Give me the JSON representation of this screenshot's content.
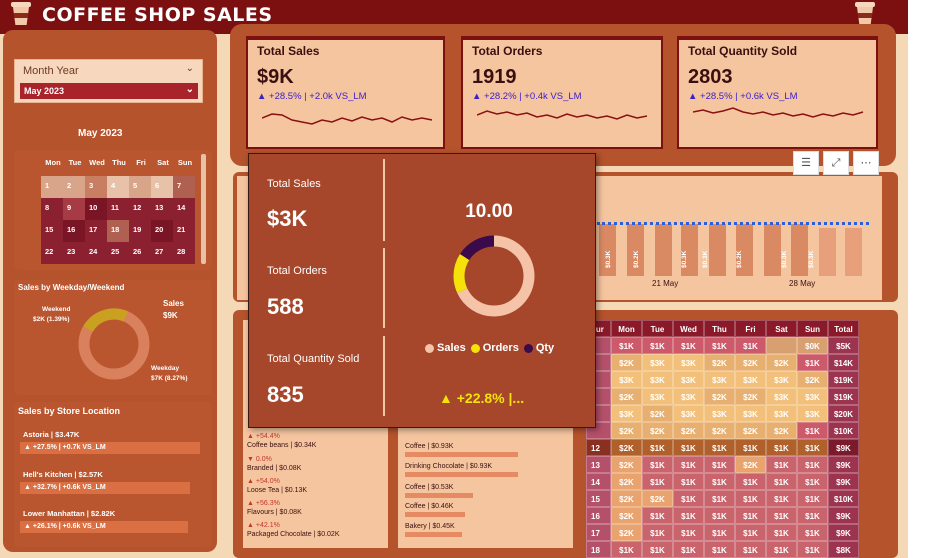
{
  "app": {
    "title": "COFFEE SHOP SALES"
  },
  "filters": {
    "month_year_label": "Month Year",
    "month_year_value": "May 2023"
  },
  "calendar": {
    "title": "May 2023",
    "weekdays": [
      "Mon",
      "Tue",
      "Wed",
      "Thu",
      "Fri",
      "Sat",
      "Sun"
    ],
    "weeks": [
      [
        "1",
        "2",
        "3",
        "4",
        "5",
        "6",
        "7"
      ],
      [
        "8",
        "9",
        "10",
        "11",
        "12",
        "13",
        "14"
      ],
      [
        "15",
        "16",
        "17",
        "18",
        "19",
        "20",
        "21"
      ],
      [
        "22",
        "23",
        "24",
        "25",
        "26",
        "27",
        "28"
      ]
    ],
    "colors": [
      [
        "#d9a58a",
        "#d9a58a",
        "#c77e63",
        "#e8c2a8",
        "#d9a58a",
        "#e8c2a8",
        "#b06050"
      ],
      [
        "#8a2030",
        "#a63a45",
        "#7a1525",
        "#8a2030",
        "#8a2030",
        "#8a2030",
        "#8a2030"
      ],
      [
        "#8a2030",
        "#7a1525",
        "#8a2030",
        "#b06050",
        "#8a2030",
        "#7a1525",
        "#8a2030"
      ],
      [
        "#8a2030",
        "#8a2030",
        "#8a2030",
        "#8a2030",
        "#8a2030",
        "#8a2030",
        "#8a2030"
      ]
    ]
  },
  "weekday_weekend": {
    "title": "Sales by Weekday/Weekend",
    "weekend_label": "Weekend",
    "weekend_value": "$2K (1.39%)",
    "sales_label": "Sales",
    "sales_value": "$9K",
    "weekday_label": "Weekday",
    "weekday_value": "$7K (8.27%)",
    "weekend_share": 0.23,
    "colors": {
      "weekday": "#d9805c",
      "weekend": "#c9a020"
    }
  },
  "store_location": {
    "title": "Sales by Store Location",
    "stores": [
      {
        "name": "Astoria | $3.47K",
        "delta": "▲ +27.5% | +0.7k VS_LM"
      },
      {
        "name": "Hell's Kitchen | $2.57K",
        "delta": "▲ +32.7% | +0.6k VS_LM"
      },
      {
        "name": "Lower Manhattan | $2.82K",
        "delta": "▲ +26.1% | +0.6k VS_LM"
      }
    ]
  },
  "kpis": [
    {
      "title": "Total Sales",
      "value": "$9K",
      "delta": "▲ +28.5% | +2.0k VS_LM"
    },
    {
      "title": "Total Orders",
      "value": "1919",
      "delta": "▲ +28.2% | +0.4k VS_LM"
    },
    {
      "title": "Total Quantity Sold",
      "value": "2803",
      "delta": "▲ +28.5% | +0.6k VS_LM"
    }
  ],
  "toolbar": {
    "filter_icon": "filter-icon",
    "focus_icon": "focus-mode-icon",
    "more_icon": "more-options-icon"
  },
  "daily_chart": {
    "type": "bar",
    "labels": [
      "$0.3K",
      "$0.2K",
      "$0.3K",
      "$0.3K",
      "$0.2K",
      "$0.3K",
      "$0.3K"
    ],
    "x_ticks": [
      "21 May",
      "28 May"
    ],
    "average_line_color": "#2b5fd9"
  },
  "categories": [
    {
      "change": "▲ +54.4%",
      "name": "Coffee beans | $0.34K"
    },
    {
      "change": "▼ 0.0%",
      "name": "Branded | $0.08K"
    },
    {
      "change": "▲ +54.0%",
      "name": "Loose Tea | $0.13K"
    },
    {
      "change": "▲ +56.3%",
      "name": "Flavours | $0.08K"
    },
    {
      "change": "▲ +42.1%",
      "name": "Packaged Chocolate | $0.02K"
    }
  ],
  "products": [
    {
      "name": "Coffee | $0.93K",
      "share": 0.75
    },
    {
      "name": "Drinking Chocolate | $0.93K",
      "share": 0.75
    },
    {
      "name": "Coffee | $0.53K",
      "share": 0.45
    },
    {
      "name": "Coffee | $0.46K",
      "share": 0.4
    },
    {
      "name": "Bakery | $0.45K",
      "share": 0.38
    }
  ],
  "heatmap": {
    "headers": [
      "our",
      "Mon",
      "Tue",
      "Wed",
      "Thu",
      "Fri",
      "Sat",
      "Sun",
      "Total"
    ],
    "rows": [
      [
        "",
        "$1K",
        "$1K",
        "$1K",
        "$1K",
        "$1K",
        "",
        "$0K",
        "$5K"
      ],
      [
        "",
        "$2K",
        "$3K",
        "$3K",
        "$2K",
        "$2K",
        "$2K",
        "$1K",
        "$14K"
      ],
      [
        "",
        "$3K",
        "$3K",
        "$3K",
        "$3K",
        "$3K",
        "$3K",
        "$2K",
        "$19K"
      ],
      [
        "",
        "$2K",
        "$3K",
        "$3K",
        "$2K",
        "$2K",
        "$3K",
        "$3K",
        "$19K"
      ],
      [
        "",
        "$3K",
        "$2K",
        "$3K",
        "$3K",
        "$3K",
        "$3K",
        "$3K",
        "$20K"
      ],
      [
        "",
        "$2K",
        "$2K",
        "$2K",
        "$2K",
        "$2K",
        "$2K",
        "$1K",
        "$10K"
      ],
      [
        "12",
        "$2K",
        "$1K",
        "$1K",
        "$1K",
        "$1K",
        "$1K",
        "$1K",
        "$9K"
      ],
      [
        "13",
        "$2K",
        "$1K",
        "$1K",
        "$1K",
        "$2K",
        "$1K",
        "$1K",
        "$9K"
      ],
      [
        "14",
        "$2K",
        "$1K",
        "$1K",
        "$1K",
        "$1K",
        "$1K",
        "$1K",
        "$9K"
      ],
      [
        "15",
        "$2K",
        "$2K",
        "$1K",
        "$1K",
        "$1K",
        "$1K",
        "$1K",
        "$10K"
      ],
      [
        "16",
        "$2K",
        "$1K",
        "$1K",
        "$1K",
        "$1K",
        "$1K",
        "$1K",
        "$9K"
      ],
      [
        "17",
        "$2K",
        "$1K",
        "$1K",
        "$1K",
        "$1K",
        "$1K",
        "$1K",
        "$9K"
      ],
      [
        "18",
        "$1K",
        "$1K",
        "$1K",
        "$1K",
        "$1K",
        "$1K",
        "$1K",
        "$8K"
      ]
    ]
  },
  "popup": {
    "sales_label": "Total Sales",
    "sales_value": "$3K",
    "orders_label": "Total Orders",
    "orders_value": "588",
    "qty_label": "Total Quantity Sold",
    "qty_value": "835",
    "center_value": "10.00",
    "legend": [
      "Sales",
      "Orders",
      "Qty"
    ],
    "colors": {
      "sales": "#f4c3a8",
      "orders": "#f4e20a",
      "qty": "#3a0a4a"
    },
    "shares": {
      "sales": 0.68,
      "orders": 0.16,
      "qty": 0.16
    },
    "footer": "▲ +22.8% |..."
  }
}
